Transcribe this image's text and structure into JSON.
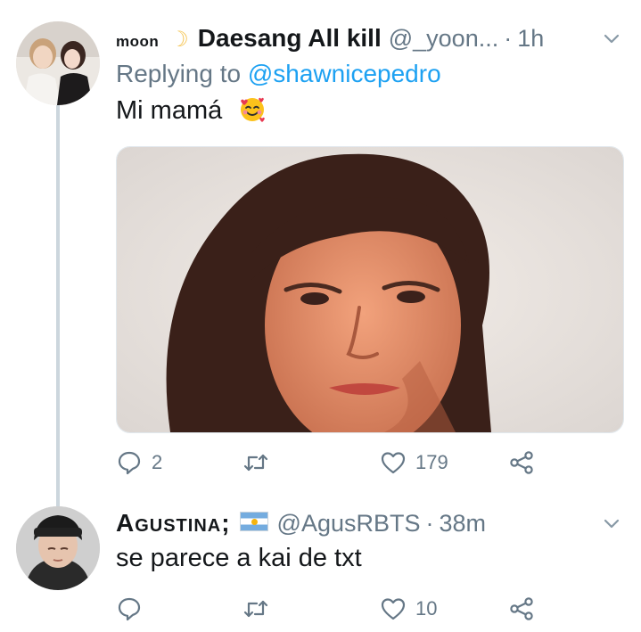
{
  "tweets": [
    {
      "author_name_small": "moon",
      "author_display_name": "Daesang All kill",
      "author_handle": "@_yoon...",
      "separator": "·",
      "time": "1h",
      "replying_prefix": "Replying to",
      "replying_to": "@shawnicepedro",
      "text": "Mi mamá",
      "emoji": "smiling-face-with-hearts",
      "actions": {
        "reply_count": "2",
        "retweet_count": "",
        "like_count": "179"
      }
    },
    {
      "author_display_name": "Agustina;",
      "flag": "argentina-flag",
      "author_handle": "@AgusRBTS",
      "separator": "·",
      "time": "38m",
      "text": "se parece a kai de txt",
      "actions": {
        "reply_count": "",
        "retweet_count": "",
        "like_count": "10"
      }
    }
  ],
  "colors": {
    "text_primary": "#14171a",
    "text_secondary": "#657786",
    "link": "#1da1f2",
    "thread_line": "#ccd6dd"
  }
}
